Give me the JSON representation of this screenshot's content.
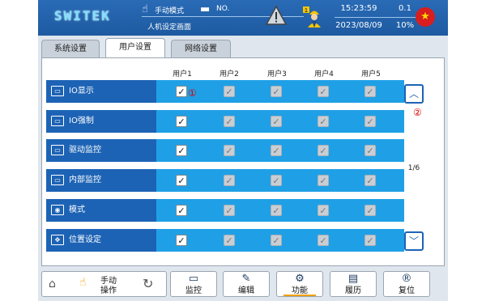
{
  "header": {
    "logo": "SWITEK",
    "mode": "手动模式",
    "file_no": "NO.",
    "screen_name": "人机设定画面",
    "time": "15:23:59",
    "date": "2023/08/09",
    "value_top": "0.1",
    "value_bottom": "10%",
    "icons": [
      "hand-pointer-icon",
      "folder-icon",
      "warning-icon",
      "worker-icon",
      "china-flag-icon"
    ]
  },
  "tabs": [
    {
      "label": "系统设置",
      "active": false
    },
    {
      "label": "用户设置",
      "active": true
    },
    {
      "label": "网络设置",
      "active": false
    }
  ],
  "columns": [
    "用户1",
    "用户2",
    "用户3",
    "用户4",
    "用户5"
  ],
  "rows": [
    {
      "label": "IO显示",
      "icon": "monitor-icon",
      "checks": [
        true,
        true,
        true,
        true,
        true
      ],
      "editable": [
        true,
        false,
        false,
        false,
        false
      ]
    },
    {
      "label": "IO强制",
      "icon": "monitor-icon",
      "checks": [
        true,
        true,
        true,
        true,
        true
      ],
      "editable": [
        true,
        false,
        false,
        false,
        false
      ]
    },
    {
      "label": "驱动监控",
      "icon": "monitor-icon",
      "checks": [
        true,
        true,
        true,
        true,
        true
      ],
      "editable": [
        true,
        false,
        false,
        false,
        false
      ]
    },
    {
      "label": "内部监控",
      "icon": "monitor-icon",
      "checks": [
        true,
        true,
        true,
        true,
        true
      ],
      "editable": [
        true,
        false,
        false,
        false,
        false
      ]
    },
    {
      "label": "模式",
      "icon": "mode-icon",
      "checks": [
        true,
        true,
        true,
        true,
        true
      ],
      "editable": [
        true,
        false,
        false,
        false,
        false
      ]
    },
    {
      "label": "位置设定",
      "icon": "position-icon",
      "checks": [
        true,
        true,
        true,
        true,
        true
      ],
      "editable": [
        true,
        false,
        false,
        false,
        false
      ]
    }
  ],
  "annotations": {
    "mark1": "①",
    "mark2": "②"
  },
  "pagination": {
    "indicator": "1/6"
  },
  "footer": {
    "manual_label_line1": "手动",
    "manual_label_line2": "操作",
    "buttons": [
      {
        "label": "监控",
        "icon": "monitor-icon"
      },
      {
        "label": "编辑",
        "icon": "edit-icon"
      },
      {
        "label": "功能",
        "icon": "gear-icon"
      },
      {
        "label": "履历",
        "icon": "history-icon"
      },
      {
        "label": "复位",
        "icon": "reset-icon"
      }
    ]
  },
  "colors": {
    "header": "#1d5aa0",
    "row_label": "#1d63b5",
    "row": "#1fa0e6",
    "active_underline": "#f0a000"
  }
}
